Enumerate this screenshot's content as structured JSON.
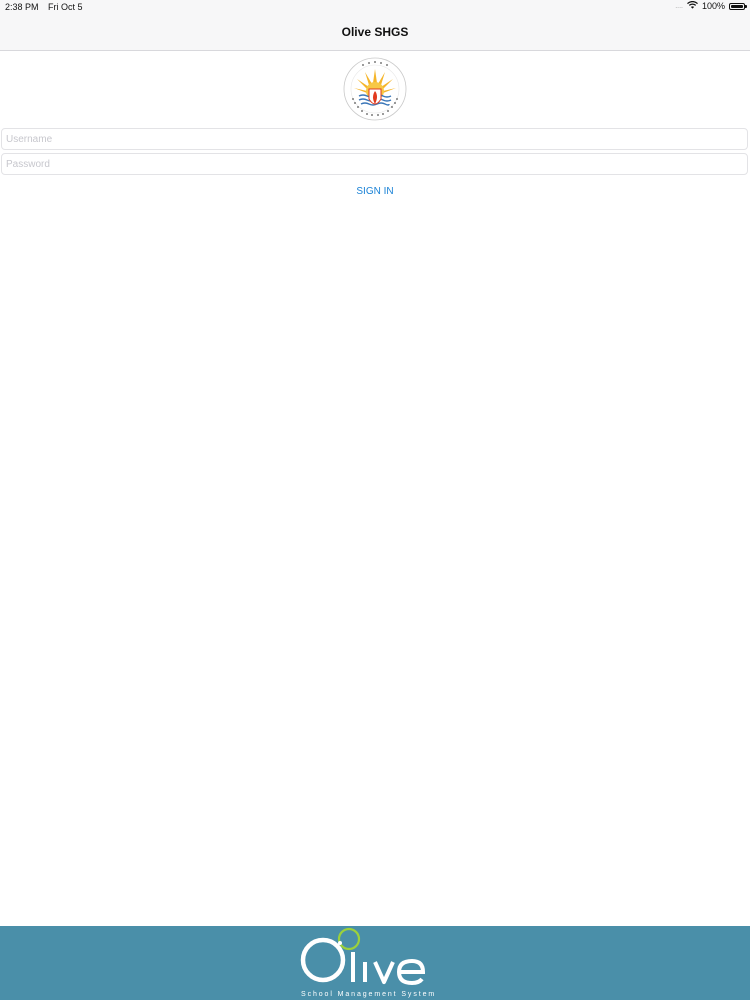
{
  "status_bar": {
    "time": "2:38 PM",
    "date": "Fri Oct 5",
    "signal": "....",
    "battery_percent": "100%"
  },
  "nav": {
    "title": "Olive SHGS"
  },
  "school_logo": {
    "icon": "school-crest-logo",
    "colors": {
      "sun": "#f5b52a",
      "flame": "#e23b1f",
      "waves": "#3a76b8"
    }
  },
  "login": {
    "username_placeholder": "Username",
    "username_value": "",
    "password_placeholder": "Password",
    "password_value": "",
    "sign_in_label": "SIGN IN",
    "accent_color": "#1a82d6"
  },
  "footer": {
    "background_color": "#4a8fa9",
    "brand_name": "Olive",
    "brand_tagline": "School Management System",
    "brand_ring_color": "#9bd13c"
  }
}
